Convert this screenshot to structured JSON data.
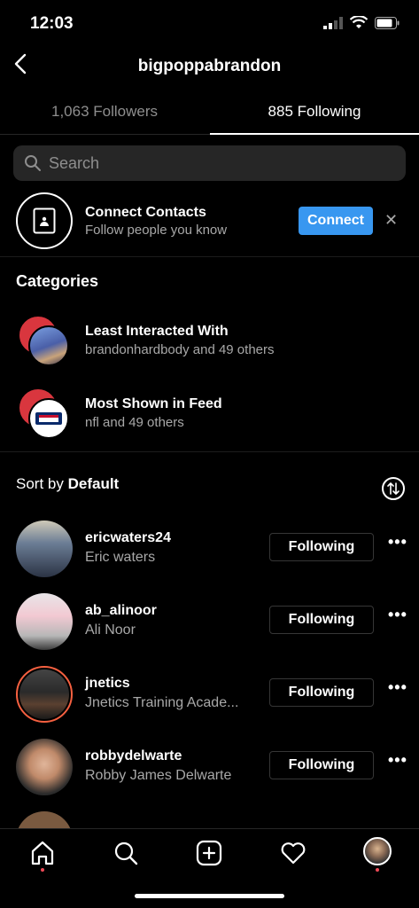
{
  "status_bar": {
    "time": "12:03"
  },
  "header": {
    "username": "bigpoppabrandon"
  },
  "tabs": [
    {
      "label": "1,063 Followers",
      "active": false
    },
    {
      "label": "885 Following",
      "active": true
    }
  ],
  "search": {
    "placeholder": "Search"
  },
  "connect": {
    "title": "Connect Contacts",
    "subtitle": "Follow people you know",
    "button_label": "Connect",
    "dismiss_label": "✕"
  },
  "categories": {
    "title": "Categories",
    "items": [
      {
        "title": "Least Interacted With",
        "subtitle": "brandonhardbody and 49 others"
      },
      {
        "title": "Most Shown in Feed",
        "subtitle": "nfl and 49 others"
      }
    ]
  },
  "sort": {
    "prefix": "Sort by",
    "value": "Default"
  },
  "following": [
    {
      "handle": "ericwaters24",
      "name": "Eric waters",
      "button": "Following",
      "more": "•••"
    },
    {
      "handle": "ab_alinoor",
      "name": "Ali Noor",
      "button": "Following",
      "more": "•••"
    },
    {
      "handle": "jnetics",
      "name": "Jnetics Training Acade...",
      "button": "Following",
      "more": "•••"
    },
    {
      "handle": "robbydelwarte",
      "name": "Robby James Delwarte",
      "button": "Following",
      "more": "•••"
    }
  ],
  "colors": {
    "accent": "#3897f0",
    "notification": "#ed4956"
  }
}
